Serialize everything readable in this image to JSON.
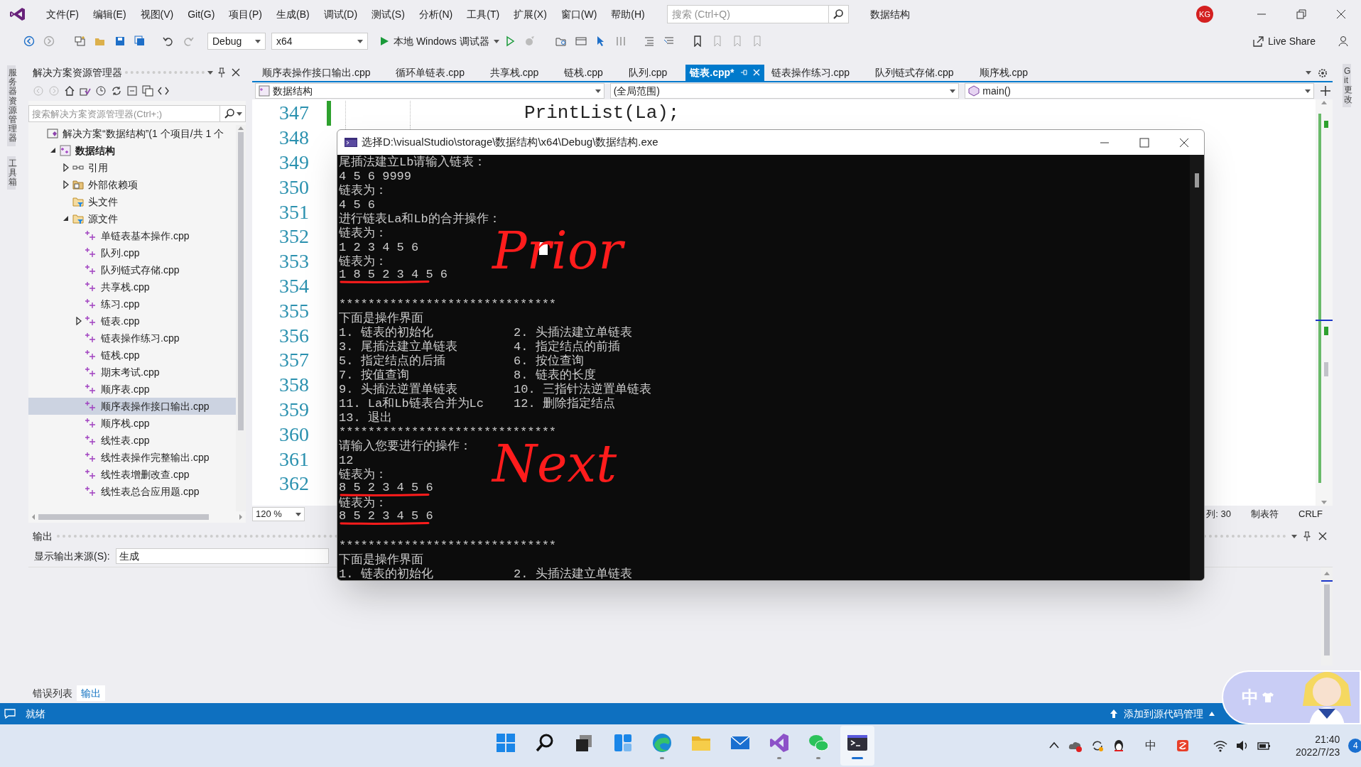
{
  "menu_bar": {
    "items": [
      "文件(F)",
      "编辑(E)",
      "视图(V)",
      "Git(G)",
      "项目(P)",
      "生成(B)",
      "调试(D)",
      "测试(S)",
      "分析(N)",
      "工具(T)",
      "扩展(X)",
      "窗口(W)",
      "帮助(H)"
    ],
    "search": {
      "placeholder": "搜索 (Ctrl+Q)"
    },
    "title": "数据结构",
    "avatar": "KG"
  },
  "toolbar": {
    "configuration": "Debug",
    "platform": "x64",
    "debugger": "本地 Windows 调试器",
    "live_share": "Live Share"
  },
  "side_strip": {
    "left": [
      "服务器资源管理器",
      "工具箱"
    ],
    "right": [
      "Git 更改"
    ]
  },
  "solution_explorer": {
    "title": "解决方案资源管理器",
    "search": {
      "placeholder": "搜索解决方案资源管理器(Ctrl+;)"
    },
    "tree": [
      {
        "kind": "solution",
        "label": "解决方案“数据结构”(1 个项目/共 1 个",
        "selected": false,
        "children": [
          {
            "kind": "project",
            "label": "数据结构",
            "expanded": true,
            "selected": false,
            "children": [
              {
                "kind": "references",
                "label": "引用",
                "expanded": false,
                "selected": false
              },
              {
                "kind": "external",
                "label": "外部依赖项",
                "expanded": false,
                "selected": false
              },
              {
                "kind": "folder",
                "label": "头文件",
                "selected": false
              },
              {
                "kind": "folder",
                "label": "源文件",
                "expanded": true,
                "selected": false,
                "children": [
                  {
                    "kind": "cpp",
                    "label": "单链表基本操作.cpp",
                    "selected": false
                  },
                  {
                    "kind": "cpp",
                    "label": "队列.cpp",
                    "selected": false
                  },
                  {
                    "kind": "cpp",
                    "label": "队列链式存储.cpp",
                    "selected": false
                  },
                  {
                    "kind": "cpp",
                    "label": "共享栈.cpp",
                    "selected": false
                  },
                  {
                    "kind": "cpp",
                    "label": "练习.cpp",
                    "selected": false
                  },
                  {
                    "kind": "cpp",
                    "label": "链表.cpp",
                    "expanded": false,
                    "selected": false
                  },
                  {
                    "kind": "cpp",
                    "label": "链表操作练习.cpp",
                    "selected": false
                  },
                  {
                    "kind": "cpp",
                    "label": "链栈.cpp",
                    "selected": false
                  },
                  {
                    "kind": "cpp",
                    "label": "期末考试.cpp",
                    "selected": false
                  },
                  {
                    "kind": "cpp",
                    "label": "顺序表.cpp",
                    "selected": false
                  },
                  {
                    "kind": "cpp",
                    "label": "顺序表操作接口输出.cpp",
                    "selected": true
                  },
                  {
                    "kind": "cpp",
                    "label": "顺序栈.cpp",
                    "selected": false
                  },
                  {
                    "kind": "cpp",
                    "label": "线性表.cpp",
                    "selected": false
                  },
                  {
                    "kind": "cpp",
                    "label": "线性表操作完整输出.cpp",
                    "selected": false
                  },
                  {
                    "kind": "cpp",
                    "label": "线性表增删改查.cpp",
                    "selected": false
                  },
                  {
                    "kind": "cpp",
                    "label": "线性表总合应用题.cpp",
                    "selected": false
                  }
                ]
              }
            ]
          }
        ]
      }
    ]
  },
  "editor": {
    "tabs": [
      {
        "label": "顺序表操作接口输出.cpp",
        "selected": false
      },
      {
        "label": "循环单链表.cpp",
        "selected": false
      },
      {
        "label": "共享栈.cpp",
        "selected": false
      },
      {
        "label": "链栈.cpp",
        "selected": false
      },
      {
        "label": "队列.cpp",
        "selected": false
      },
      {
        "label": "链表.cpp*",
        "selected": true
      },
      {
        "label": "链表操作练习.cpp",
        "selected": false
      },
      {
        "label": "队列链式存储.cpp",
        "selected": false
      },
      {
        "label": "顺序栈.cpp",
        "selected": false
      }
    ],
    "nav": [
      "数据结构",
      "(全局范围)",
      "main()"
    ],
    "lines": [
      {
        "number": "347",
        "code": "PrintList(La);",
        "changed": true
      },
      {
        "number": "348",
        "changed": false
      },
      {
        "number": "349",
        "changed": false
      },
      {
        "number": "350",
        "changed": false
      },
      {
        "number": "351",
        "changed": false
      },
      {
        "number": "352",
        "changed": false
      },
      {
        "number": "353",
        "changed": false
      },
      {
        "number": "354",
        "changed": false
      },
      {
        "number": "355",
        "changed": false
      },
      {
        "number": "356",
        "changed": false
      },
      {
        "number": "357",
        "changed": false
      },
      {
        "number": "358",
        "changed": false
      },
      {
        "number": "359",
        "changed": false
      },
      {
        "number": "360",
        "changed": false
      },
      {
        "number": "361",
        "changed": false
      },
      {
        "number": "362",
        "changed": false
      }
    ],
    "zoom": "120 %",
    "status": [
      "列: 30",
      "制表符",
      "CRLF"
    ]
  },
  "console": {
    "title": "选择D:\\visualStudio\\storage\\数据结构\\x64\\Debug\\数据结构.exe",
    "lines": [
      {
        "kind": "line",
        "text": "尾插法建立Lb请输入链表："
      },
      {
        "kind": "line",
        "text": "4 5 6 9999"
      },
      {
        "kind": "line",
        "text": "链表为："
      },
      {
        "kind": "line",
        "text": "4 5 6"
      },
      {
        "kind": "line",
        "text": "进行链表La和Lb的合并操作："
      },
      {
        "kind": "line",
        "text": "链表为："
      },
      {
        "kind": "line",
        "text": "1 2 3 4 5 6",
        "cursor": true
      },
      {
        "kind": "line",
        "text": "链表为：",
        "note": "Prior"
      },
      {
        "kind": "line",
        "text": "1 8 5 2 3 4 5 6",
        "underlined": true
      },
      {
        "kind": "blank"
      },
      {
        "kind": "line",
        "text": "******************************"
      },
      {
        "kind": "line",
        "text": "下面是操作界面"
      },
      {
        "kind": "pair",
        "left": "1. 链表的初始化",
        "right": "2. 头插法建立单链表"
      },
      {
        "kind": "pair",
        "left": "3. 尾插法建立单链表",
        "right": "4. 指定结点的前插"
      },
      {
        "kind": "pair",
        "left": "5. 指定结点的后插",
        "right": "6. 按位查询"
      },
      {
        "kind": "pair",
        "left": "7. 按值查询",
        "right": "8. 链表的长度"
      },
      {
        "kind": "pair",
        "left": "9. 头插法逆置单链表",
        "right": "10. 三指针法逆置单链表"
      },
      {
        "kind": "pair",
        "left": "11. La和Lb链表合并为Lc",
        "right": "12. 删除指定结点"
      },
      {
        "kind": "line",
        "text": "13. 退出"
      },
      {
        "kind": "line",
        "text": "******************************"
      },
      {
        "kind": "line",
        "text": "请输入您要进行的操作："
      },
      {
        "kind": "line",
        "text": "12"
      },
      {
        "kind": "line",
        "text": "链表为：",
        "note": "Next"
      },
      {
        "kind": "line",
        "text": "8 5 2 3 4 5 6",
        "underlined": true
      },
      {
        "kind": "line",
        "text": "链表为："
      },
      {
        "kind": "line",
        "text": "8 5 2 3 4 5 6",
        "underlined": true
      },
      {
        "kind": "blank"
      },
      {
        "kind": "line",
        "text": "******************************"
      },
      {
        "kind": "line",
        "text": "下面是操作界面"
      },
      {
        "kind": "pair",
        "left": "1. 链表的初始化",
        "right": "2. 头插法建立单链表"
      }
    ]
  },
  "output": {
    "title": "输出",
    "source_label": "显示输出来源(S):",
    "source": "生成"
  },
  "bottom_tabs": [
    {
      "label": "错误列表",
      "selected": false
    },
    {
      "label": "输出",
      "selected": true
    }
  ],
  "status_bar": {
    "text": "就绪",
    "source_control": "添加到源代码管理"
  },
  "ime_widget": {
    "label": "中"
  },
  "taskbar": {
    "apps": [
      {
        "kind": "start",
        "running": false,
        "active": false
      },
      {
        "kind": "search",
        "running": false,
        "active": false
      },
      {
        "kind": "taskview",
        "running": false,
        "active": false
      },
      {
        "kind": "widgets",
        "running": false,
        "active": false
      },
      {
        "kind": "edge",
        "running": true,
        "active": false
      },
      {
        "kind": "explorer",
        "running": false,
        "active": false
      },
      {
        "kind": "mail",
        "running": false,
        "active": false
      },
      {
        "kind": "vs",
        "running": true,
        "active": false
      },
      {
        "kind": "wechat",
        "running": true,
        "active": false
      },
      {
        "kind": "terminal",
        "running": true,
        "active": true
      }
    ],
    "tray": {
      "ime": "中",
      "time": "21:40",
      "date": "2022/7/23",
      "badge": "4"
    }
  }
}
